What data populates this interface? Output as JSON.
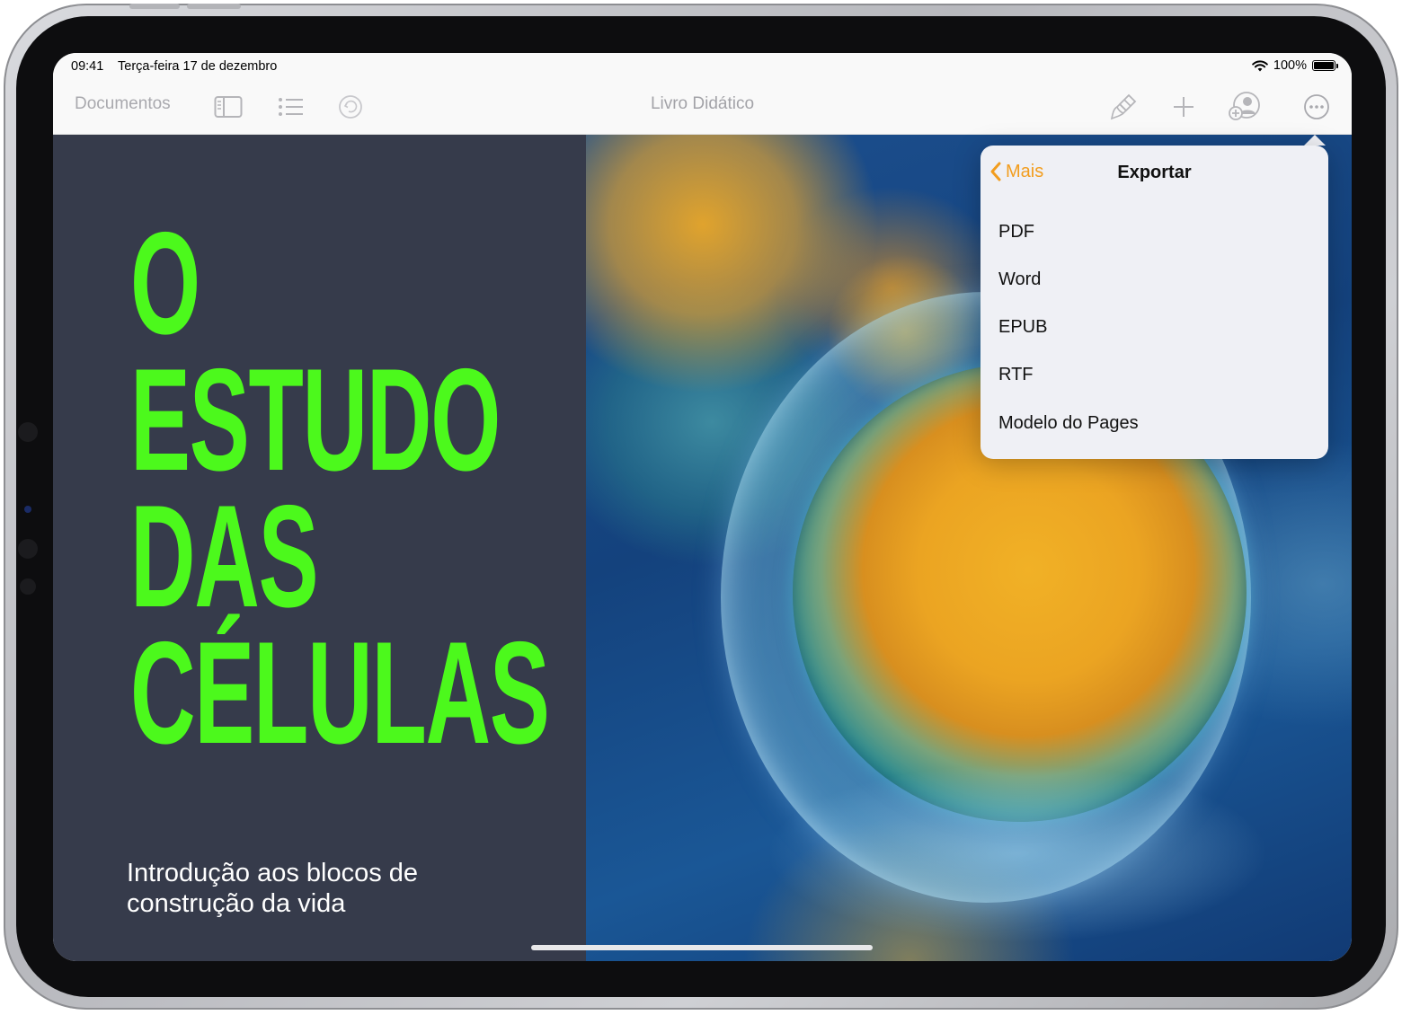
{
  "status": {
    "time": "09:41",
    "date": "Terça-feira 17 de dezembro",
    "battery": "100%"
  },
  "toolbar": {
    "documents_label": "Documentos",
    "doc_title": "Livro Didático"
  },
  "document": {
    "title_lines": [
      "O",
      "ESTUDO",
      "DAS",
      "CÉLULAS"
    ],
    "subtitle_lines": [
      "Introdução aos blocos de",
      "construção da vida"
    ],
    "title_color": "#4cf91c",
    "panel_color": "#363b4b"
  },
  "popover": {
    "back_label": "Mais",
    "title": "Exportar",
    "items": [
      "PDF",
      "Word",
      "EPUB",
      "RTF",
      "Modelo do Pages"
    ],
    "accent_color": "#f29d1e"
  }
}
